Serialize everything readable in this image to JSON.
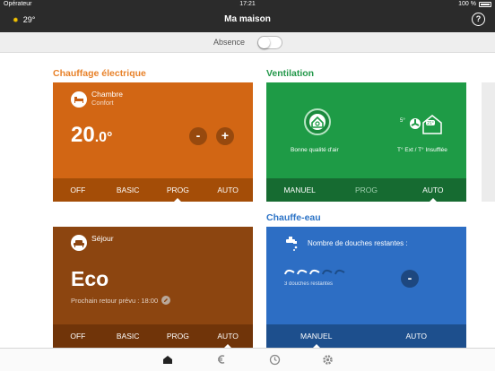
{
  "status_bar": {
    "carrier": "Opérateur",
    "time": "17:21",
    "battery": "100 %"
  },
  "header": {
    "weather_temp": "29°",
    "title": "Ma maison",
    "help_symbol": "?"
  },
  "absence": {
    "label": "Absence",
    "enabled": false
  },
  "chauffage": {
    "title": "Chauffage électrique",
    "color_title": "#e8822a",
    "zones": [
      {
        "room": "Chambre",
        "sub": "Confort",
        "temp_int": "20",
        "temp_dec": ".0°",
        "minus": "-",
        "plus": "+",
        "color": "#d26614",
        "footer_color": "#a44d07",
        "modes": [
          "OFF",
          "BASIC",
          "PROG",
          "AUTO"
        ],
        "active_mode": "PROG"
      },
      {
        "room": "Séjour",
        "mode_label": "Eco",
        "next_return": "Prochain retour prévu : 18:00",
        "color": "#8c4510",
        "footer_color": "#703409",
        "modes": [
          "OFF",
          "BASIC",
          "PROG",
          "AUTO"
        ],
        "active_mode": "AUTO"
      }
    ]
  },
  "ventilation": {
    "title": "Ventilation",
    "color_title": "#23984a",
    "air_quality_label": "Bonne qualité d'air",
    "temp_label": "T° Ext / T° Insufflée",
    "temp_ext": "5°",
    "temp_insufflee": "21°",
    "color": "#1e9b46",
    "footer_color": "#166b31",
    "modes": [
      "MANUEL",
      "PROG",
      "AUTO"
    ],
    "active_mode": "AUTO"
  },
  "chauffe_eau": {
    "title": "Chauffe-eau",
    "color_title": "#2c73c6",
    "showers_title": "Nombre de douches restantes :",
    "showers_text": "3 douches restantes",
    "showers_remaining": 3,
    "showers_total": 5,
    "minus": "-",
    "color": "#2d6ec4",
    "footer_color": "#1d4f8d",
    "modes": [
      "MANUEL",
      "AUTO"
    ],
    "active_mode": "MANUEL"
  },
  "tabs": [
    {
      "name": "home-icon",
      "active": true
    },
    {
      "name": "euro-icon",
      "active": false
    },
    {
      "name": "clock-icon",
      "active": false
    },
    {
      "name": "gear-icon",
      "active": false
    }
  ]
}
